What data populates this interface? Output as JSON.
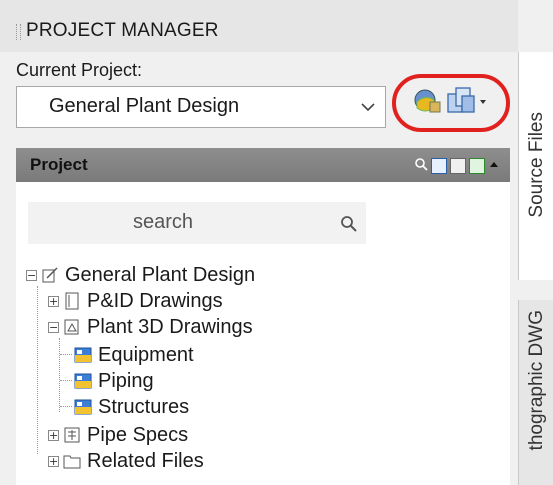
{
  "panel": {
    "title": "PROJECT MANAGER"
  },
  "current_project": {
    "label": "Current Project:",
    "selected": "General Plant Design"
  },
  "project_panel": {
    "title": "Project",
    "search_placeholder": "search"
  },
  "tree": {
    "root": "General Plant Design",
    "pid": "P&ID Drawings",
    "plant3d": "Plant 3D Drawings",
    "equipment": "Equipment",
    "piping": "Piping",
    "structures": "Structures",
    "pipespecs": "Pipe Specs",
    "related": "Related Files"
  },
  "side_tabs": {
    "source": "Source Files",
    "ortho": "thographic DWG"
  },
  "colors": {
    "highlight": "#e0211e",
    "header": "#808080"
  }
}
